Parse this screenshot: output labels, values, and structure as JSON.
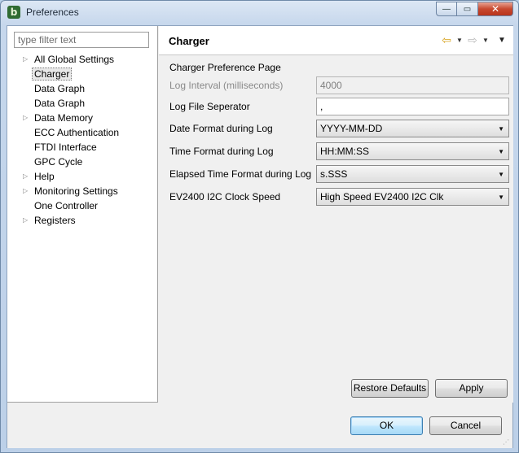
{
  "window": {
    "title": "Preferences",
    "app_icon_glyph": "b",
    "controls": {
      "minimize": "—",
      "maximize": "▭",
      "close": "✕"
    }
  },
  "filter": {
    "placeholder": "type filter text",
    "value": ""
  },
  "tree": {
    "items": [
      {
        "label": "All Global Settings",
        "expandable": true,
        "selected": false
      },
      {
        "label": "Charger",
        "expandable": false,
        "selected": true
      },
      {
        "label": "Data Graph",
        "expandable": false,
        "selected": false
      },
      {
        "label": "Data Graph",
        "expandable": false,
        "selected": false
      },
      {
        "label": "Data Memory",
        "expandable": true,
        "selected": false
      },
      {
        "label": "ECC Authentication",
        "expandable": false,
        "selected": false
      },
      {
        "label": "FTDI Interface",
        "expandable": false,
        "selected": false
      },
      {
        "label": "GPC Cycle",
        "expandable": false,
        "selected": false
      },
      {
        "label": "Help",
        "expandable": true,
        "selected": false
      },
      {
        "label": "Monitoring Settings",
        "expandable": true,
        "selected": false
      },
      {
        "label": "One Controller",
        "expandable": false,
        "selected": false
      },
      {
        "label": "Registers",
        "expandable": true,
        "selected": false
      }
    ]
  },
  "page": {
    "title": "Charger",
    "description": "Charger Preference Page",
    "nav": {
      "back_icon": "⇦",
      "forward_icon": "⇨",
      "dropdown_icon": "▼",
      "menu_icon": "▼"
    },
    "log_interval": {
      "label": "Log Interval (milliseconds)",
      "value": "4000"
    },
    "log_file_separator": {
      "label": "Log File Seperator",
      "value": ","
    },
    "date_format": {
      "label": "Date Format during Log",
      "value": "YYYY-MM-DD"
    },
    "time_format": {
      "label": "Time Format during Log",
      "value": "HH:MM:SS"
    },
    "elapsed_format": {
      "label": "Elapsed Time Format during Log",
      "value": "s.SSS"
    },
    "clock_speed": {
      "label": "EV2400 I2C Clock Speed",
      "value": "High Speed EV2400 I2C Clk"
    },
    "restore_defaults_label": "Restore Defaults",
    "apply_label": "Apply"
  },
  "footer": {
    "ok_label": "OK",
    "cancel_label": "Cancel"
  },
  "colors": {
    "accent_nav": "#d7a21c",
    "default_button_border": "#3c7fb1"
  }
}
